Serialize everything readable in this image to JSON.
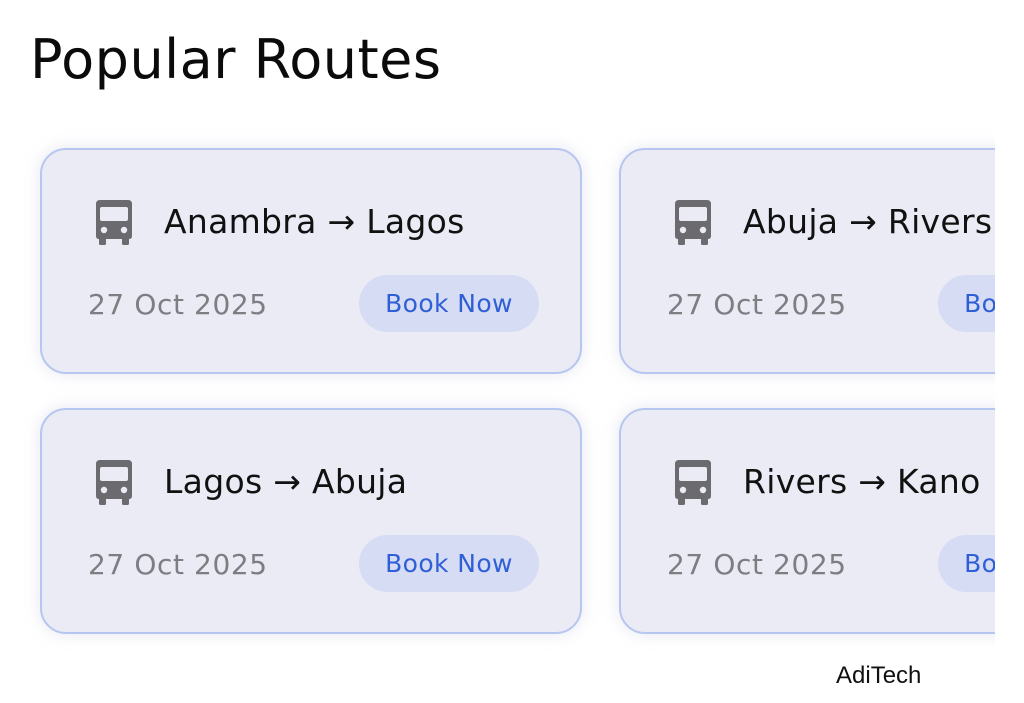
{
  "header": {
    "title": "Popular Routes"
  },
  "routes": [
    {
      "label": "Anambra → Lagos",
      "date": "27 Oct 2025",
      "button": "Book Now",
      "icon": "bus-icon"
    },
    {
      "label": "Abuja → Rivers",
      "date": "27 Oct 2025",
      "button": "Book Now",
      "icon": "bus-icon"
    },
    {
      "label": "Lagos → Abuja",
      "date": "27 Oct 2025",
      "button": "Book Now",
      "icon": "bus-icon"
    },
    {
      "label": "Rivers → Kano",
      "date": "27 Oct 2025",
      "button": "Book Now",
      "icon": "bus-icon"
    }
  ],
  "footer": {
    "brand": "AdiTech"
  },
  "colors": {
    "card_bg": "#eaebf5",
    "card_border": "#b7c6f0",
    "button_bg": "#d6dcf3",
    "button_text": "#2f5fd6",
    "icon": "#6b6b6f"
  }
}
